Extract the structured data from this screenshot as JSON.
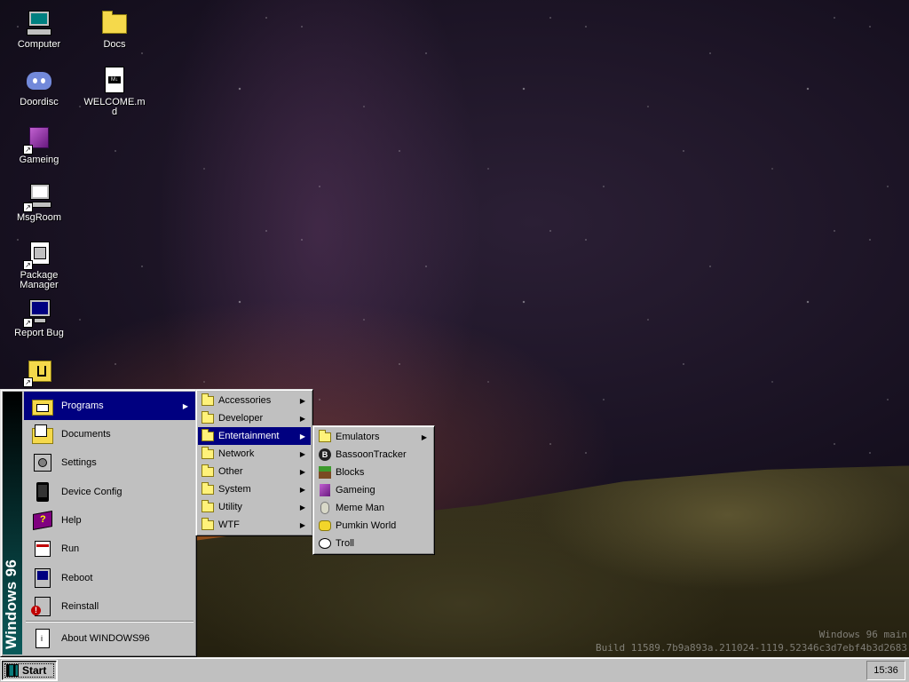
{
  "desktop": {
    "icons": [
      {
        "label": "Computer"
      },
      {
        "label": "Docs"
      },
      {
        "label": "Doordisc"
      },
      {
        "label": "WELCOME.md"
      },
      {
        "label": "Gameing"
      },
      {
        "label": "MsgRoom"
      },
      {
        "label": "Package Manager"
      },
      {
        "label": "Report Bug"
      }
    ],
    "build_line1": "Windows 96 main",
    "build_line2": "Build 11589.7b9a893a.211024-1119.52346c3d7ebf4b3d2683"
  },
  "start_menu": {
    "sidebar_text": "Windows 96",
    "items": [
      {
        "label": "Programs"
      },
      {
        "label": "Documents"
      },
      {
        "label": "Settings"
      },
      {
        "label": "Device Config"
      },
      {
        "label": "Help"
      },
      {
        "label": "Run"
      },
      {
        "label": "Reboot"
      },
      {
        "label": "Reinstall"
      },
      {
        "label": "About WINDOWS96"
      }
    ]
  },
  "programs_menu": {
    "items": [
      {
        "label": "Accessories"
      },
      {
        "label": "Developer"
      },
      {
        "label": "Entertainment"
      },
      {
        "label": "Network"
      },
      {
        "label": "Other"
      },
      {
        "label": "System"
      },
      {
        "label": "Utility"
      },
      {
        "label": "WTF"
      }
    ]
  },
  "entertainment_menu": {
    "items": [
      {
        "label": "Emulators"
      },
      {
        "label": "BassoonTracker"
      },
      {
        "label": "Blocks"
      },
      {
        "label": "Gameing"
      },
      {
        "label": "Meme Man"
      },
      {
        "label": "Pumkin World"
      },
      {
        "label": "Troll"
      }
    ]
  },
  "taskbar": {
    "start_label": "Start",
    "clock": "15:36"
  },
  "colors": {
    "selection": "#000080",
    "chrome": "#c0c0c0",
    "sidebar_gradient_end": "#0a5a5a"
  }
}
